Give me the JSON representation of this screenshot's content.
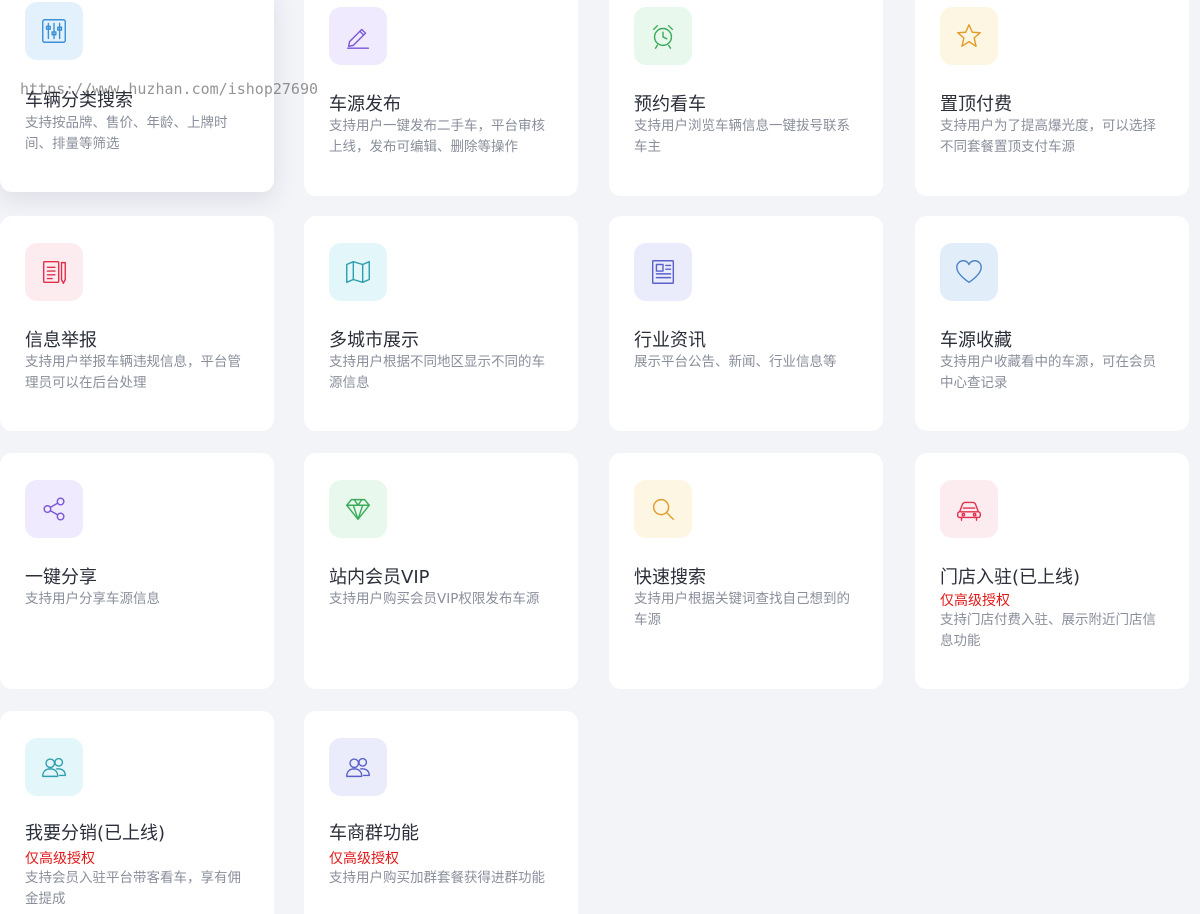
{
  "watermark": "https://www.huzhan.com/ishop27690",
  "cards": [
    {
      "title": "车辆分类搜索",
      "badge": "",
      "desc": "支持按品牌、售价、年龄、上牌时间、排量等筛选",
      "icon": "sliders-icon",
      "icon_bg": "#e3f1fc",
      "icon_color": "#3d8fd6"
    },
    {
      "title": "车源发布",
      "badge": "",
      "desc": "支持用户一键发布二手车，平台审核上线，发布可编辑、删除等操作",
      "icon": "pencil-icon",
      "icon_bg": "#efeafd",
      "icon_color": "#7a55d6"
    },
    {
      "title": "预约看车",
      "badge": "",
      "desc": "支持用户浏览车辆信息一键拔号联系车主",
      "icon": "alarm-clock-icon",
      "icon_bg": "#e8f8ec",
      "icon_color": "#3bab5a"
    },
    {
      "title": "置顶付费",
      "badge": "",
      "desc": "支持用户为了提高爆光度，可以选择不同套餐置顶支付车源",
      "icon": "star-icon",
      "icon_bg": "#fdf6e3",
      "icon_color": "#e39b2a"
    },
    {
      "title": "信息举报",
      "badge": "",
      "desc": "支持用户举报车辆违规信息，平台管理员可以在后台处理",
      "icon": "report-icon",
      "icon_bg": "#fdecef",
      "icon_color": "#e0304d"
    },
    {
      "title": "多城市展示",
      "badge": "",
      "desc": "支持用户根据不同地区显示不同的车源信息",
      "icon": "map-icon",
      "icon_bg": "#e3f7fa",
      "icon_color": "#2e9fae"
    },
    {
      "title": "行业资讯",
      "badge": "",
      "desc": "展示平台公告、新闻、行业信息等",
      "icon": "newspaper-icon",
      "icon_bg": "#ebecfb",
      "icon_color": "#5a5fc8"
    },
    {
      "title": "车源收藏",
      "badge": "",
      "desc": "支持用户收藏看中的车源，可在会员中心查记录",
      "icon": "heart-icon",
      "icon_bg": "#e1eefa",
      "icon_color": "#4d84c4"
    },
    {
      "title": "一键分享",
      "badge": "",
      "desc": "支持用户分享车源信息",
      "icon": "share-icon",
      "icon_bg": "#efeafd",
      "icon_color": "#7a55d6"
    },
    {
      "title": "站内会员VIP",
      "badge": "",
      "desc": "支持用户购买会员VIP权限发布车源",
      "icon": "diamond-icon",
      "icon_bg": "#e8f8ec",
      "icon_color": "#3bab5a"
    },
    {
      "title": "快速搜索",
      "badge": "",
      "desc": "支持用户根据关键词查找自己想到的车源",
      "icon": "search-icon",
      "icon_bg": "#fdf6e3",
      "icon_color": "#e39b2a"
    },
    {
      "title": "门店入驻(已上线)",
      "badge": "仅高级授权",
      "desc": "支持门店付费入驻、展示附近门店信息功能",
      "icon": "car-icon",
      "icon_bg": "#fdecef",
      "icon_color": "#e0304d"
    },
    {
      "title": "我要分销(已上线)",
      "badge": "仅高级授权",
      "desc": "支持会员入驻平台带客看车，享有佣金提成",
      "icon": "users-icon",
      "icon_bg": "#e3f7fa",
      "icon_color": "#2e9fae"
    },
    {
      "title": "车商群功能",
      "badge": "仅高级授权",
      "desc": "支持用户购买加群套餐获得进群功能",
      "icon": "users-icon",
      "icon_bg": "#ebecfb",
      "icon_color": "#5a5fc8"
    }
  ]
}
